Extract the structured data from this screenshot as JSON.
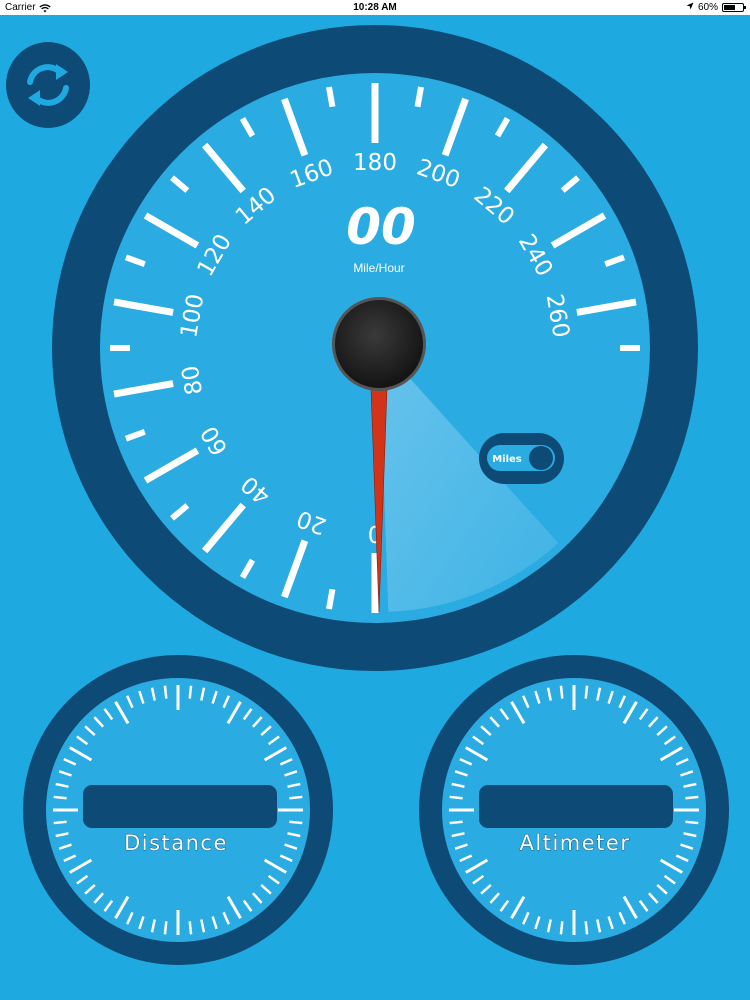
{
  "status_bar": {
    "carrier": "Carrier",
    "time": "10:28 AM",
    "battery": "60%",
    "battery_level": 0.6
  },
  "speedometer": {
    "value": "00",
    "unit": "Mile/Hour",
    "tick_labels": [
      "0",
      "20",
      "40",
      "60",
      "80",
      "100",
      "120",
      "140",
      "160",
      "180",
      "200",
      "220",
      "240",
      "260"
    ],
    "needle_value": 0,
    "unit_toggle_label": "Miles"
  },
  "distance_gauge": {
    "label": "Distance"
  },
  "altimeter_gauge": {
    "label": "Altimeter"
  },
  "colors": {
    "background": "#1fa9e1",
    "ring": "#0d4a75",
    "face": "#2aabe2",
    "needle": "#d2341a",
    "ticks": "#ffffff"
  },
  "icons": {
    "refresh": "refresh-icon",
    "wifi": "wifi-icon",
    "location": "location-arrow-icon",
    "battery": "battery-icon"
  }
}
